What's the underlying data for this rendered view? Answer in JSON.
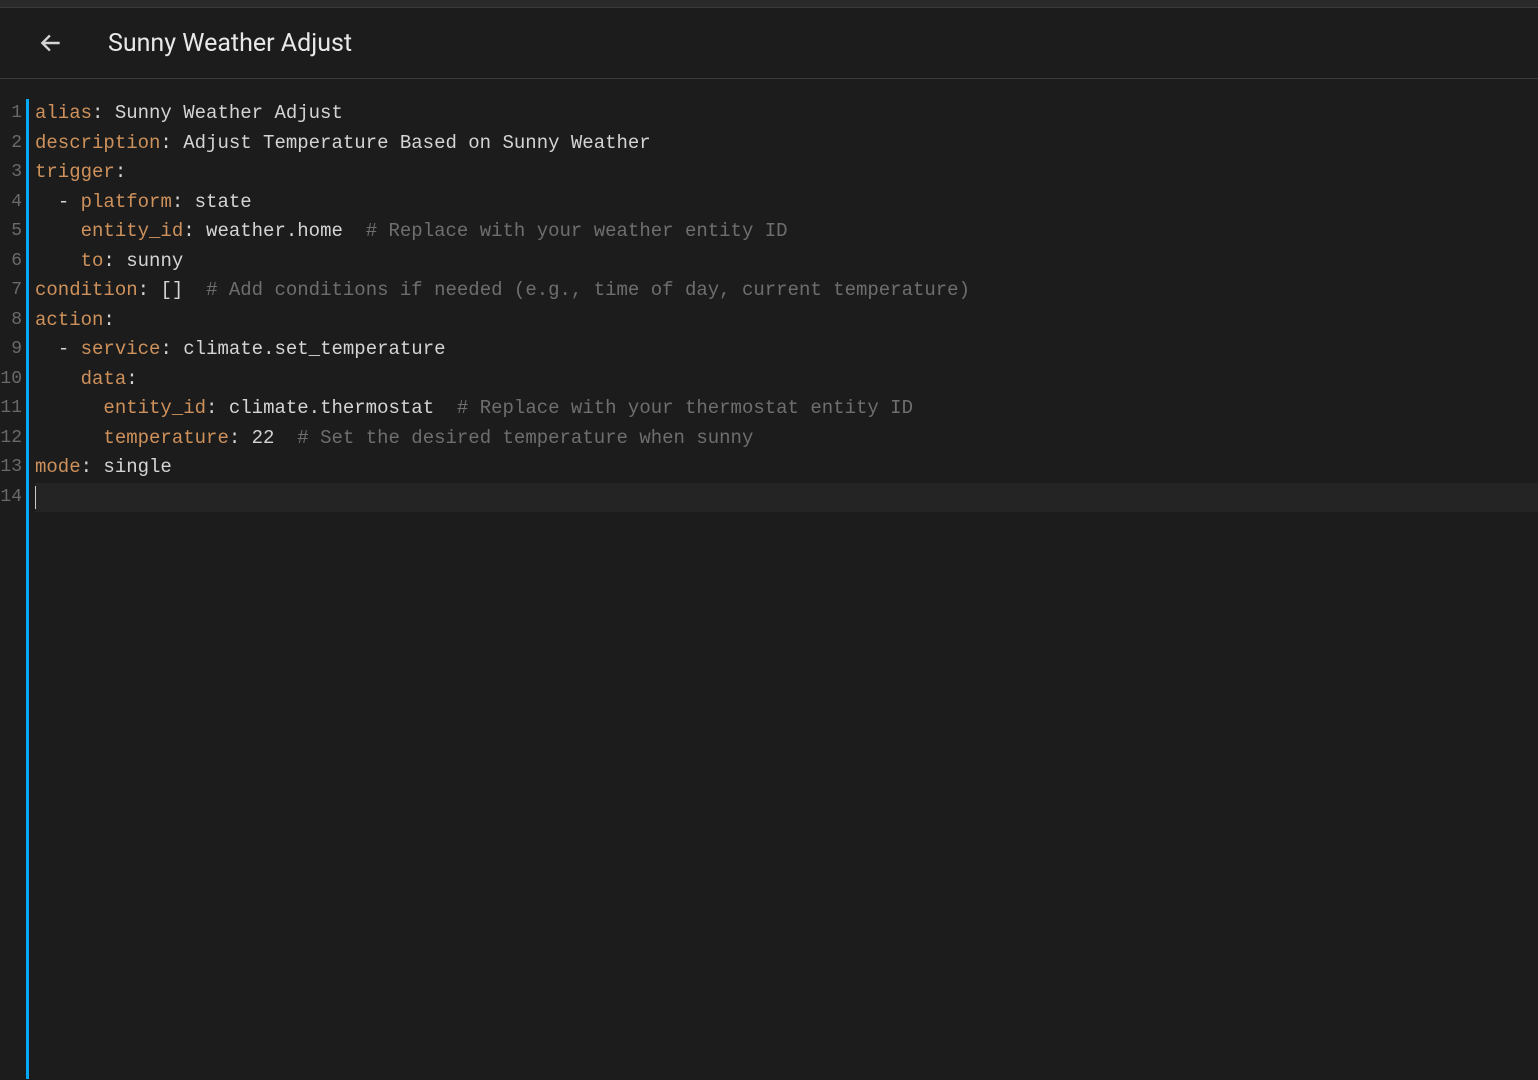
{
  "header": {
    "title": "Sunny Weather Adjust"
  },
  "editor": {
    "line_count": 14,
    "active_line": 14,
    "lines": {
      "1": {
        "key": "alias",
        "colon": ": ",
        "value": "Sunny Weather Adjust"
      },
      "2": {
        "key": "description",
        "colon": ": ",
        "value": "Adjust Temperature Based on Sunny Weather"
      },
      "3": {
        "key": "trigger",
        "colon": ":"
      },
      "4": {
        "indent": "  ",
        "dash": "- ",
        "key": "platform",
        "colon": ": ",
        "value": "state"
      },
      "5": {
        "indent": "    ",
        "key": "entity_id",
        "colon": ": ",
        "value": "weather.home",
        "spacer": "  ",
        "comment": "# Replace with your weather entity ID"
      },
      "6": {
        "indent": "    ",
        "key": "to",
        "colon": ": ",
        "value": "sunny"
      },
      "7": {
        "key": "condition",
        "colon": ": ",
        "value": "[]",
        "spacer": "  ",
        "comment": "# Add conditions if needed (e.g., time of day, current temperature)"
      },
      "8": {
        "key": "action",
        "colon": ":"
      },
      "9": {
        "indent": "  ",
        "dash": "- ",
        "key": "service",
        "colon": ": ",
        "value": "climate.set_temperature"
      },
      "10": {
        "indent": "    ",
        "key": "data",
        "colon": ":"
      },
      "11": {
        "indent": "      ",
        "key": "entity_id",
        "colon": ": ",
        "value": "climate.thermostat",
        "spacer": "  ",
        "comment": "# Replace with your thermostat entity ID"
      },
      "12": {
        "indent": "      ",
        "key": "temperature",
        "colon": ": ",
        "value": "22",
        "spacer": "  ",
        "comment": "# Set the desired temperature when sunny"
      },
      "13": {
        "key": "mode",
        "colon": ": ",
        "value": "single"
      },
      "14": {
        "blank": ""
      }
    },
    "line_numbers": {
      "1": "1",
      "2": "2",
      "3": "3",
      "4": "4",
      "5": "5",
      "6": "6",
      "7": "7",
      "8": "8",
      "9": "9",
      "10": "10",
      "11": "11",
      "12": "12",
      "13": "13",
      "14": "14"
    }
  }
}
